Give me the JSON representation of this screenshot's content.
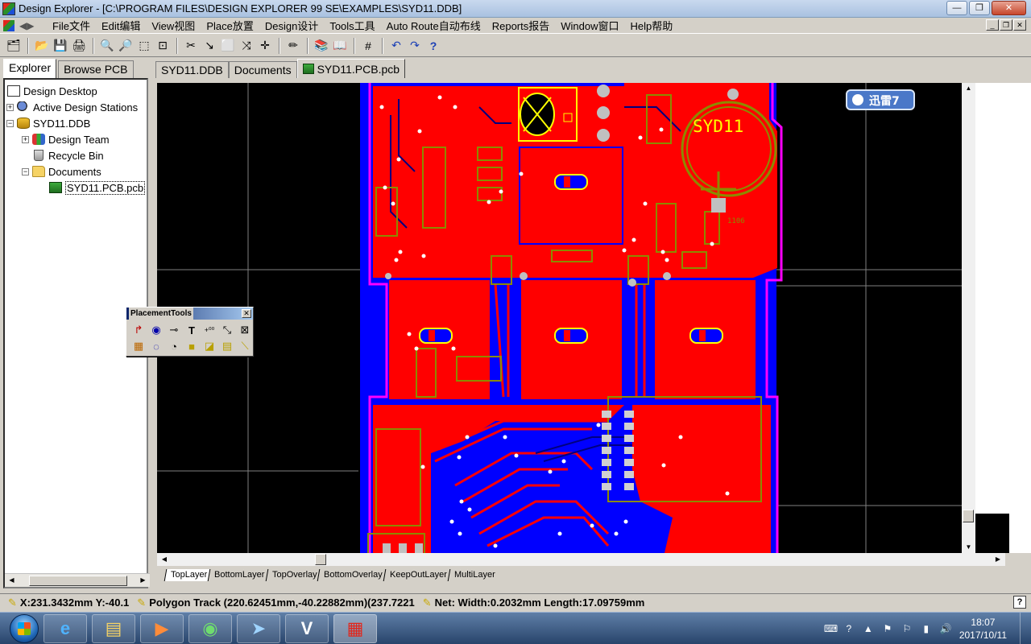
{
  "window": {
    "title": "Design Explorer - [C:\\PROGRAM FILES\\DESIGN EXPLORER 99 SE\\EXAMPLES\\SYD11.DDB]",
    "minimize": "—",
    "restore": "❐",
    "close": "✕"
  },
  "menu": {
    "items": [
      "File文件",
      "Edit编辑",
      "View视图",
      "Place放置",
      "Design设计",
      "Tools工具",
      "Auto Route自动布线",
      "Reports报告",
      "Window窗口",
      "Help帮助"
    ]
  },
  "explorer": {
    "tabs": [
      "Explorer",
      "Browse PCB"
    ],
    "tree": [
      {
        "label": "Design Desktop"
      },
      {
        "label": "Active Design Stations"
      },
      {
        "label": "SYD11.DDB"
      },
      {
        "label": "Design Team"
      },
      {
        "label": "Recycle Bin"
      },
      {
        "label": "Documents"
      },
      {
        "label": "SYD11.PCB.pcb"
      }
    ]
  },
  "doc_tabs": [
    "SYD11.DDB",
    "Documents",
    "SYD11.PCB.pcb"
  ],
  "pcb": {
    "silkscreen_text": "SYD11",
    "overlay_badge": "迅雷7",
    "small_label": "1106",
    "colors": {
      "background": "#000000",
      "top_layer": "#ff0000",
      "bottom_layer": "#0000ff",
      "overlay": "#ffff00",
      "outline": "#ff00ff",
      "pad": "#c0c0c0"
    }
  },
  "layers": [
    "TopLayer",
    "BottomLayer",
    "TopOverlay",
    "BottomOverlay",
    "KeepOutLayer",
    "MultiLayer"
  ],
  "placement_tools": {
    "title": "PlacementTools",
    "buttons": [
      "Place Line",
      "Place Pad",
      "Place Via",
      "Place String",
      "Place Coordinate",
      "Place Dimension",
      "Place Origin",
      "Place Room",
      "Place Arc Center",
      "Place Arc Edge",
      "Place Fill",
      "Place Polygon",
      "Place Copper",
      "Split Plane"
    ]
  },
  "status": {
    "coords": "X:231.3432mm Y:-40.1",
    "selection": "Polygon Track (220.62451mm,-40.22882mm)(237.7221",
    "net": "Net: Width:0.2032mm Length:17.09759mm"
  },
  "taskbar": {
    "time": "18:07",
    "date": "2017/10/11"
  }
}
